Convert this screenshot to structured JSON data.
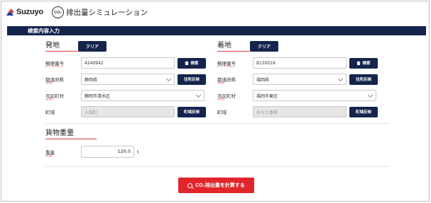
{
  "header": {
    "logo_text": "Suzuyo",
    "co2_badge": "CO₂",
    "app_title": "排出量シミュレーション"
  },
  "section": {
    "title": "検索内容入力"
  },
  "origin": {
    "title": "発地",
    "clear_label": "クリア",
    "postal_label": "郵便番号",
    "postal_sub": "(ハイフンなし)",
    "postal_value": "4240942",
    "search_label": "検索",
    "pref_label": "都道府県",
    "pref_sub": "(必須)",
    "pref_value": "静岡県",
    "address_reflect_label": "住所反映",
    "city_label": "市区町村",
    "city_sub": "(必須)",
    "city_value": "静岡市清水区",
    "town_label": "町域",
    "town_value": "入船町",
    "town_reflect_label": "町域反映"
  },
  "destination": {
    "title": "着地",
    "clear_label": "クリア",
    "postal_label": "郵便番号",
    "postal_sub": "(ハイフンなし)",
    "postal_value": "8130019",
    "search_label": "検索",
    "pref_label": "都道府県",
    "pref_sub": "(必須)",
    "pref_value": "福岡県",
    "address_reflect_label": "住所反映",
    "city_label": "市区町村",
    "city_sub": "(必須)",
    "city_value": "福岡市東区",
    "town_label": "町域",
    "town_value": "みなと香椎",
    "town_reflect_label": "町域反映"
  },
  "cargo": {
    "title": "貨物重量",
    "weight_label": "重量",
    "weight_sub": "(必須)",
    "weight_value": "120.0",
    "unit": "t"
  },
  "actions": {
    "calculate_label": "CO₂排出量を計算する"
  },
  "colors": {
    "navy": "#14244c",
    "accent_red": "#e0262b",
    "logo_blue": "#1a3d8f",
    "logo_red": "#e23a3a"
  }
}
